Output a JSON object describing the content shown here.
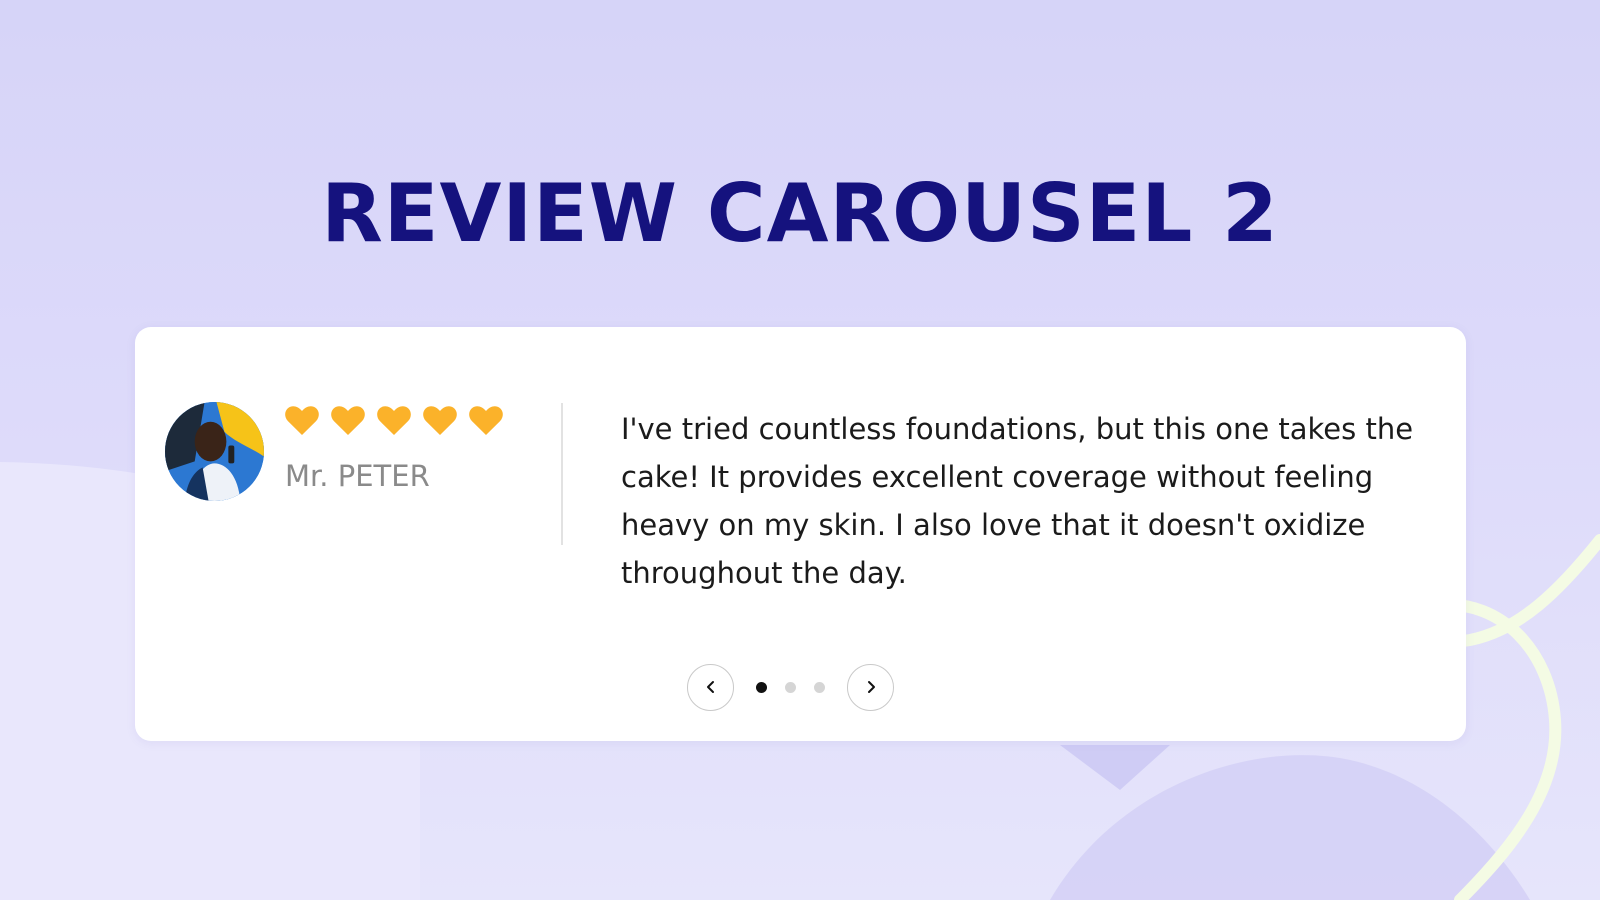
{
  "page": {
    "title": "REVIEW CAROUSEL 2"
  },
  "review": {
    "reviewer_name": "Mr. PETER",
    "rating": 5,
    "rating_max": 5,
    "rating_icon": "heart-icon",
    "text": "I've tried countless foundations, but this one takes the cake! It provides excellent coverage without feeling heavy on my skin. I also love that it doesn't oxidize throughout the day.",
    "avatar": "avatar"
  },
  "carousel": {
    "prev_icon": "chevron-left-icon",
    "next_icon": "chevron-right-icon",
    "slide_count": 3,
    "active_slide": 1
  },
  "colors": {
    "title": "#15127e",
    "heart": "#fbb22a",
    "background": "#dddafa",
    "card": "#ffffff",
    "active_dot": "#111111",
    "inactive_dot": "#d5d5d5",
    "ribbon": "#f4fbe4"
  }
}
